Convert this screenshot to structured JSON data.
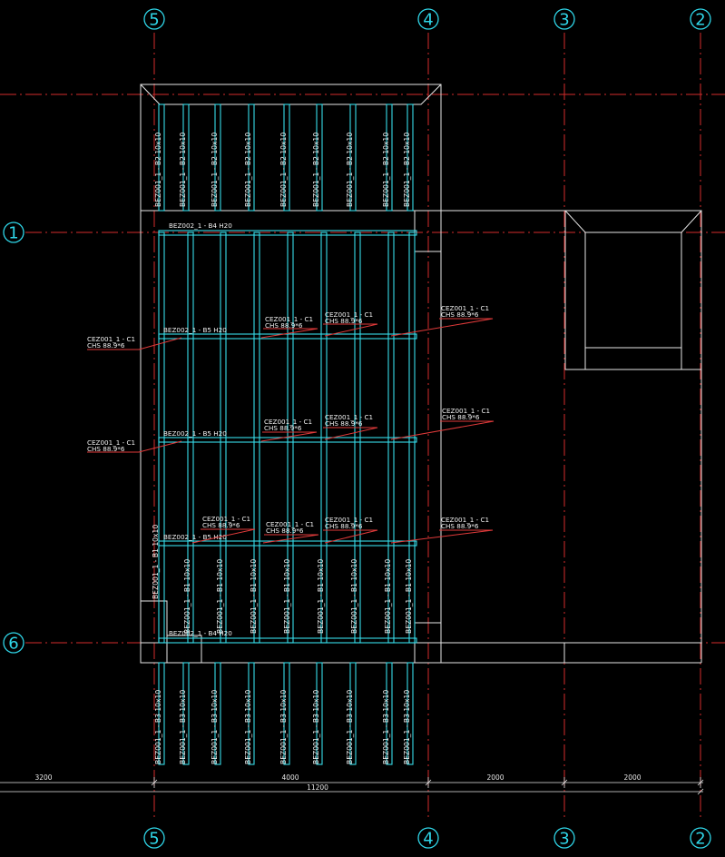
{
  "grid_axes": {
    "vertical": [
      "5",
      "4",
      "3",
      "2"
    ],
    "horizontal": [
      "1",
      "6"
    ]
  },
  "member_labels": {
    "B2": "BEZ001_1 - B2  10x10",
    "B1": "BEZ001_1 - B1  10x10",
    "B3": "BEZ001_1 - B3  10x10",
    "B1_long": "BEZ001_1 - B1 10x10",
    "B4_top": "BEZ002_1 - B4  H20",
    "B4_bottom": "BEZ002_1 - B4  H20",
    "B5": "BEZ002_1 - B5  H20"
  },
  "column_tag": {
    "line1": "CEZ001_1 - C1",
    "line2": "CHS 88.9*6"
  },
  "dimensions": {
    "segments": [
      "3200",
      "4000",
      "2000",
      "2000"
    ],
    "total": "11200"
  },
  "colors": {
    "background": "#000000",
    "grid_line": "#d42b2b",
    "structure": "#36dcea",
    "outline": "#e6e6e6",
    "leader": "#e03a3a"
  }
}
